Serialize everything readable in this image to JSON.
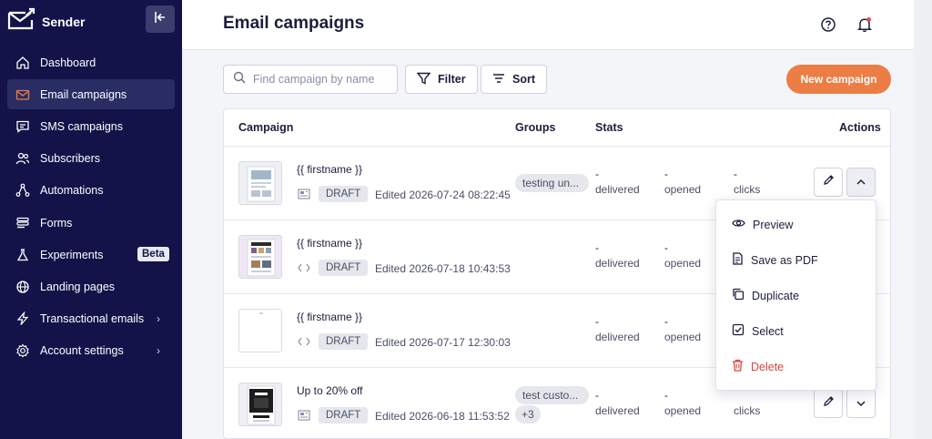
{
  "sidebar": {
    "brand": "Sender",
    "items": [
      {
        "label": "Dashboard",
        "icon": "home-icon"
      },
      {
        "label": "Email campaigns",
        "icon": "mail-icon",
        "active": true
      },
      {
        "label": "SMS campaigns",
        "icon": "chat-icon"
      },
      {
        "label": "Subscribers",
        "icon": "users-icon"
      },
      {
        "label": "Automations",
        "icon": "automation-icon"
      },
      {
        "label": "Forms",
        "icon": "forms-icon"
      },
      {
        "label": "Experiments",
        "icon": "flask-icon",
        "badge": "Beta"
      },
      {
        "label": "Landing pages",
        "icon": "globe-icon"
      },
      {
        "label": "Transactional emails",
        "icon": "bolt-icon",
        "chevron": "›"
      },
      {
        "label": "Account settings",
        "icon": "gear-icon",
        "chevron": "›"
      }
    ]
  },
  "header": {
    "title": "Email campaigns"
  },
  "toolbar": {
    "search_placeholder": "Find campaign by name",
    "filter_label": "Filter",
    "sort_label": "Sort",
    "new_campaign_label": "New campaign"
  },
  "table": {
    "columns": {
      "campaign": "Campaign",
      "groups": "Groups",
      "stats": "Stats",
      "actions": "Actions"
    },
    "stat_labels": {
      "delivered": "delivered",
      "opened": "opened",
      "clicks": "clicks"
    },
    "dash": "-",
    "rows": [
      {
        "name": "{{ firstname }}",
        "status": "DRAFT",
        "edited": "Edited 2026-07-24 08:22:45",
        "groups": [
          "testing un..."
        ],
        "more": "",
        "type": "template"
      },
      {
        "name": "{{ firstname }}",
        "status": "DRAFT",
        "edited": "Edited 2026-07-18 10:43:53",
        "groups": [],
        "more": "",
        "type": "code"
      },
      {
        "name": "{{ firstname }}",
        "status": "DRAFT",
        "edited": "Edited 2026-07-17 12:30:03",
        "groups": [],
        "more": "",
        "type": "code"
      },
      {
        "name": "Up to 20% off",
        "status": "DRAFT",
        "edited": "Edited 2026-06-18 11:53:52",
        "groups": [
          "test custo..."
        ],
        "more": "+3",
        "type": "template"
      }
    ]
  },
  "menu": {
    "items": [
      {
        "label": "Preview",
        "icon": "eye-icon"
      },
      {
        "label": "Save as PDF",
        "icon": "pdf-icon"
      },
      {
        "label": "Duplicate",
        "icon": "copy-icon"
      },
      {
        "label": "Select",
        "icon": "checkbox-icon"
      },
      {
        "label": "Delete",
        "icon": "trash-icon"
      }
    ]
  },
  "colors": {
    "sidebar": "#13134a",
    "accent": "#ec7d45",
    "danger": "#d9453b",
    "active_icon": "#ec7d45"
  }
}
